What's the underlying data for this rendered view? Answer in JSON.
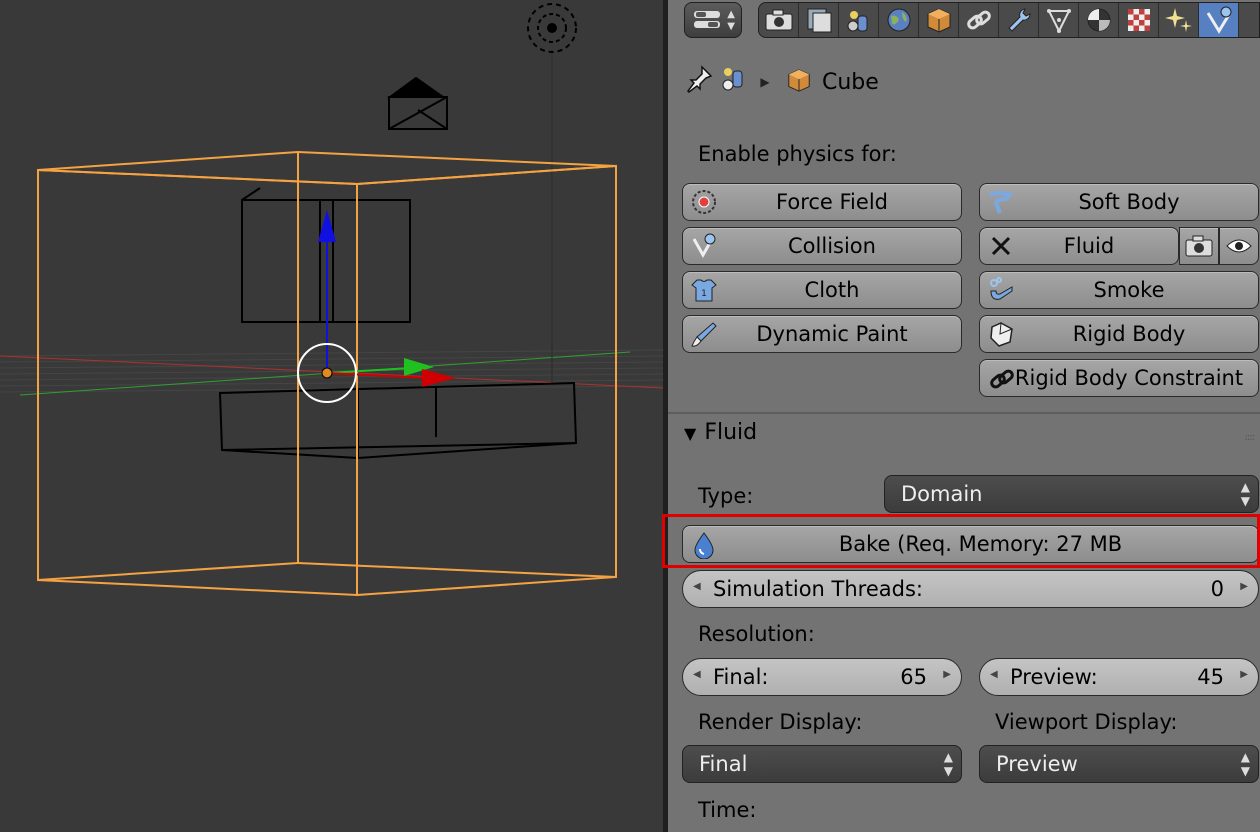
{
  "breadcrumb": {
    "object_name": "Cube"
  },
  "physics": {
    "heading": "Enable physics for:",
    "buttons": {
      "force_field": "Force Field",
      "soft_body": "Soft Body",
      "collision": "Collision",
      "fluid": "Fluid",
      "cloth": "Cloth",
      "smoke": "Smoke",
      "dynamic_paint": "Dynamic Paint",
      "rigid_body": "Rigid Body",
      "rigid_body_constraint": "Rigid Body Constraint"
    }
  },
  "fluid_panel": {
    "title": "Fluid",
    "type_label": "Type:",
    "type_value": "Domain",
    "bake_label": "Bake (Req. Memory: 27 MB",
    "sim_threads_label": "Simulation Threads:",
    "sim_threads_value": "0",
    "resolution_label": "Resolution:",
    "final_label": "Final:",
    "final_value": "65",
    "preview_label": "Preview:",
    "preview_value": "45",
    "render_display_label": "Render Display:",
    "render_display_value": "Final",
    "viewport_display_label": "Viewport Display:",
    "viewport_display_value": "Preview",
    "time_label": "Time:"
  },
  "colors": {
    "selection_orange": "#f5a242",
    "active_tab": "#5680c2",
    "highlight_red": "#e00000",
    "axis_x": "#d00000",
    "axis_y": "#20c020",
    "axis_z": "#1010e0"
  }
}
